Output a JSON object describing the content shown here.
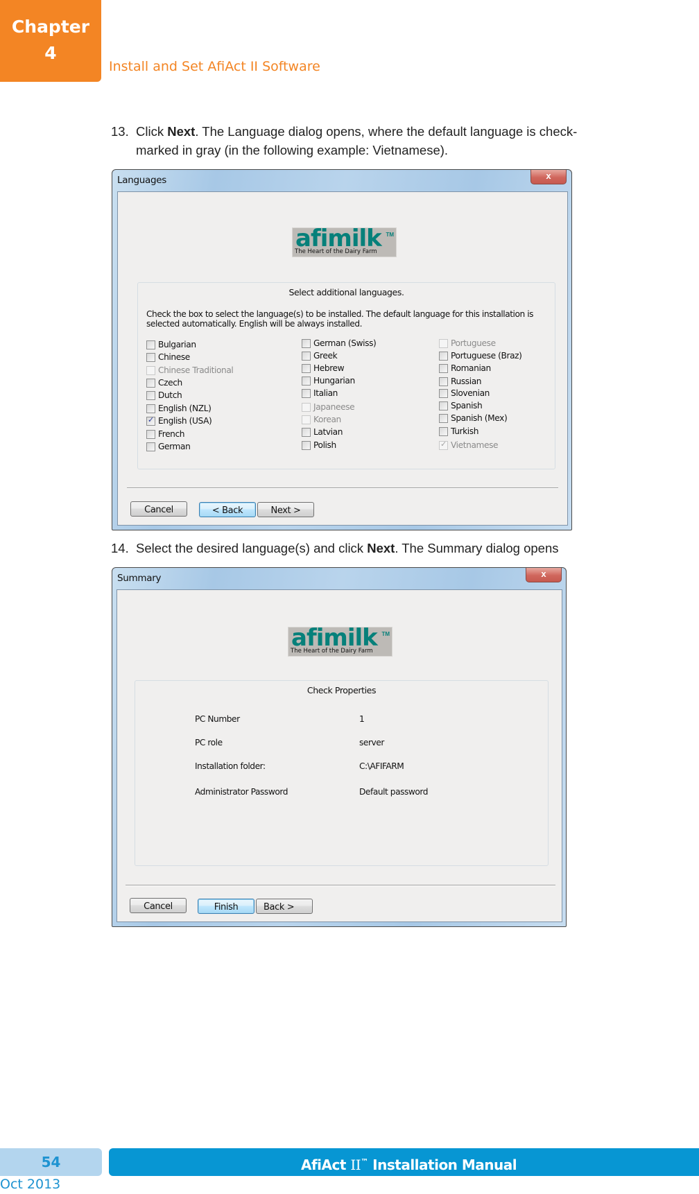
{
  "header": {
    "chapter_label": "Chapter",
    "chapter_number": "4",
    "section_title": "Install and Set AfiAct II Software"
  },
  "step13": {
    "number": "13.",
    "pre": "Click ",
    "bold": "Next",
    "post": ". The Language dialog opens, where the default language is check-",
    "line2": "marked in gray (in the following example: Vietnamese)."
  },
  "languages_dialog": {
    "title": "Languages",
    "close_label": "x",
    "logo": {
      "brand": "afimilk",
      "tm": "TM",
      "tagline": "The Heart of the Dairy Farm"
    },
    "group_title": "Select additional languages.",
    "description": "Check the box to select the language(s) to be installed. The default language for this installation is selected automatically. English will be always installed.",
    "columns": [
      [
        {
          "label": "Bulgarian",
          "checked": false,
          "disabled": false
        },
        {
          "label": "Chinese",
          "checked": false,
          "disabled": false
        },
        {
          "label": "Chinese Traditional",
          "checked": false,
          "disabled": true
        },
        {
          "label": "Czech",
          "checked": false,
          "disabled": false
        },
        {
          "label": "Dutch",
          "checked": false,
          "disabled": false
        },
        {
          "label": "English (NZL)",
          "checked": false,
          "disabled": false
        },
        {
          "label": "English (USA)",
          "checked": true,
          "disabled": false
        },
        {
          "label": "French",
          "checked": false,
          "disabled": false
        },
        {
          "label": "German",
          "checked": false,
          "disabled": false
        }
      ],
      [
        {
          "label": "German (Swiss)",
          "checked": false,
          "disabled": false
        },
        {
          "label": "Greek",
          "checked": false,
          "disabled": false
        },
        {
          "label": "Hebrew",
          "checked": false,
          "disabled": false
        },
        {
          "label": "Hungarian",
          "checked": false,
          "disabled": false
        },
        {
          "label": "Italian",
          "checked": false,
          "disabled": false
        },
        {
          "label": "Japaneese",
          "checked": false,
          "disabled": true
        },
        {
          "label": "Korean",
          "checked": false,
          "disabled": true
        },
        {
          "label": "Latvian",
          "checked": false,
          "disabled": false
        },
        {
          "label": "Polish",
          "checked": false,
          "disabled": false
        }
      ],
      [
        {
          "label": "Portuguese",
          "checked": false,
          "disabled": true
        },
        {
          "label": "Portuguese (Braz)",
          "checked": false,
          "disabled": false
        },
        {
          "label": "Romanian",
          "checked": false,
          "disabled": false
        },
        {
          "label": "Russian",
          "checked": false,
          "disabled": false
        },
        {
          "label": "Slovenian",
          "checked": false,
          "disabled": false
        },
        {
          "label": "Spanish",
          "checked": false,
          "disabled": false
        },
        {
          "label": "Spanish (Mex)",
          "checked": false,
          "disabled": false
        },
        {
          "label": "Turkish",
          "checked": false,
          "disabled": false
        },
        {
          "label": "Vietnamese",
          "checked": true,
          "disabled": true
        }
      ]
    ],
    "buttons": {
      "cancel": "Cancel",
      "back": "< Back",
      "next": "Next >"
    }
  },
  "step14": {
    "number": "14.",
    "pre": "Select the desired language(s) and click ",
    "bold": "Next",
    "post": ". The Summary dialog opens"
  },
  "summary_dialog": {
    "title": "Summary",
    "close_label": "x",
    "logo": {
      "brand": "afimilk",
      "tm": "TM",
      "tagline": "The Heart of the Dairy Farm"
    },
    "group_title": "Check Properties",
    "properties": [
      {
        "label": "PC Number",
        "value": "1"
      },
      {
        "label": "PC role",
        "value": "server"
      },
      {
        "label": "Installation folder:",
        "value": "C:\\AFIFARM"
      },
      {
        "label": "Administrator Password",
        "value": "Default password"
      }
    ],
    "buttons": {
      "cancel": "Cancel",
      "finish": "Finish",
      "back": "Back >"
    }
  },
  "footer": {
    "page_number": "54",
    "manual_pre": "AfiAct ",
    "manual_roman": "II",
    "manual_tm": "™",
    "manual_post": " Installation Manual",
    "date": "Oct 2013"
  },
  "colors": {
    "accent_orange": "#f38524",
    "footer_blue": "#0796d3",
    "page_num_bg": "#b3d5ee",
    "brand_teal": "#06807a"
  }
}
